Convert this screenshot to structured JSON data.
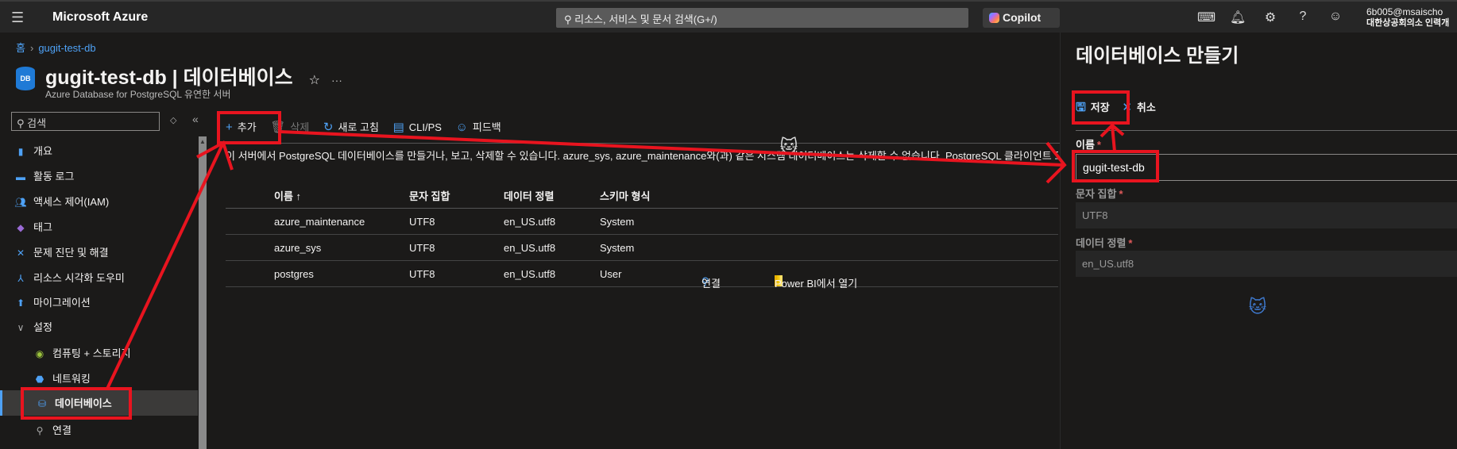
{
  "topbar": {
    "brand": "Microsoft Azure",
    "search_placeholder": "리소스, 서비스 및 문서 검색(G+/)",
    "copilot": "Copilot",
    "user_email": "6b005@msaischo",
    "user_org": "대한상공회의소 인력개"
  },
  "breadcrumb": {
    "home": "홈",
    "current": "gugit-test-db"
  },
  "header": {
    "title": "gugit-test-db | 데이터베이스",
    "subtitle": "Azure Database for PostgreSQL 유연한 서버",
    "db_icon_text": "DB"
  },
  "sidebar": {
    "search_placeholder": "검색",
    "items": [
      {
        "label": "개요",
        "icon": "overview-icon"
      },
      {
        "label": "활동 로그",
        "icon": "activity-log-icon"
      },
      {
        "label": "액세스 제어(IAM)",
        "icon": "iam-icon"
      },
      {
        "label": "태그",
        "icon": "tag-icon"
      },
      {
        "label": "문제 진단 및 해결",
        "icon": "wrench-icon"
      },
      {
        "label": "리소스 시각화 도우미",
        "icon": "visualizer-icon"
      },
      {
        "label": "마이그레이션",
        "icon": "migration-icon"
      },
      {
        "label": "설정",
        "icon": "chevron-down-icon"
      },
      {
        "label": "컴퓨팅 + 스토리지",
        "icon": "compute-icon"
      },
      {
        "label": "네트워킹",
        "icon": "network-icon"
      },
      {
        "label": "데이터베이스",
        "icon": "database-icon"
      },
      {
        "label": "연결",
        "icon": "connect-icon"
      }
    ]
  },
  "toolbar": {
    "add": "추가",
    "delete": "삭제",
    "refresh": "새로 고침",
    "cli": "CLI/PS",
    "feedback": "피드백"
  },
  "info_text": "이 서버에서 PostgreSQL 데이터베이스를 만들거나, 보고, 삭제할 수 있습니다. azure_sys, azure_maintenance와(과) 같은 시스템 데이터베이스는 삭제할 수 없습니다. PostgreSQL 클라이언트 도구를",
  "table": {
    "headers": [
      "이름 ↑",
      "문자 집합",
      "데이터 정렬",
      "스키마 형식"
    ],
    "rows": [
      {
        "name": "azure_maintenance",
        "charset": "UTF8",
        "collation": "en_US.utf8",
        "schema": "System"
      },
      {
        "name": "azure_sys",
        "charset": "UTF8",
        "collation": "en_US.utf8",
        "schema": "System"
      },
      {
        "name": "postgres",
        "charset": "UTF8",
        "collation": "en_US.utf8",
        "schema": "User",
        "connect": "연결",
        "powerbi": "Power BI에서 열기"
      }
    ]
  },
  "panel": {
    "title": "데이터베이스 만들기",
    "save": "저장",
    "cancel": "취소",
    "name_label": "이름",
    "name_value": "gugit-test-db",
    "charset_label": "문자 집합",
    "charset_value": "UTF8",
    "collation_label": "데이터 정렬",
    "collation_value": "en_US.utf8",
    "required": "*"
  },
  "colors": {
    "accent": "#4ea1f5",
    "annotation": "#e8141f"
  }
}
